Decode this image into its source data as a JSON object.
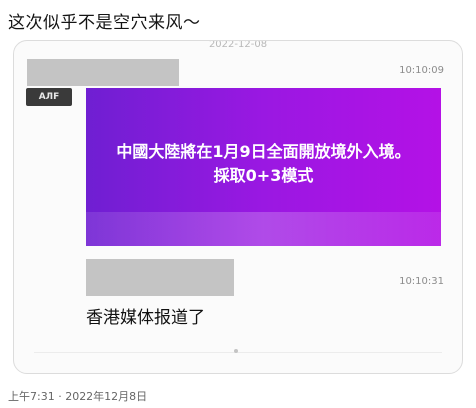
{
  "post": {
    "text": "这次似乎不是空穴来风～",
    "meta": "上午7:31 · 2022年12月8日"
  },
  "chat": {
    "date_divider": "2022-12-08",
    "avatar_text": "AЛF",
    "messages": [
      {
        "time": "10:10:09",
        "banner_lines": [
          "中國大陸將在1月9日全面開放境外入境。",
          "採取0+3模式"
        ]
      },
      {
        "time": "10:10:31",
        "text": "香港媒体报道了"
      }
    ]
  },
  "colors": {
    "banner_left": "#6f1fd2",
    "banner_right": "#b411e6"
  }
}
